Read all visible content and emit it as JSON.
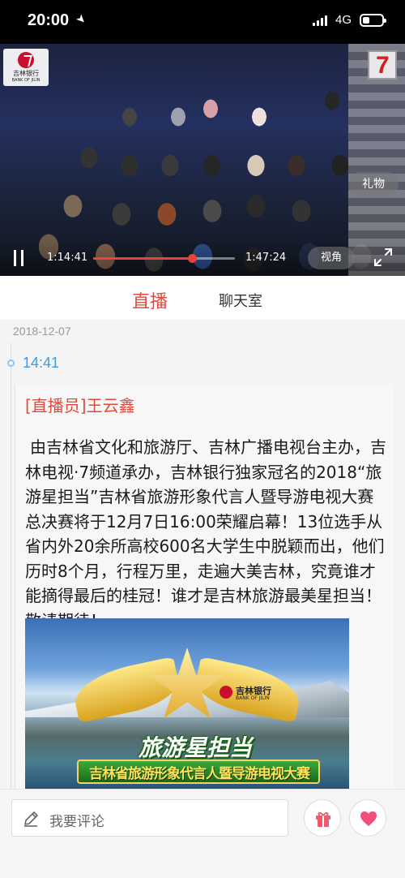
{
  "status_bar": {
    "time": "20:00",
    "network": "4G"
  },
  "player": {
    "channel_logo": {
      "text_cn": "吉林银行",
      "text_en": "BANK OF JILIN"
    },
    "gift_label": "礼物",
    "current_time": "1:14:41",
    "total_time": "1:47:24",
    "progress": 0.695,
    "angle_label": "视角"
  },
  "tabs": [
    {
      "label": "直播",
      "active": true
    },
    {
      "label": "聊天室",
      "active": false
    }
  ],
  "feed": {
    "date": "2018-12-07",
    "post": {
      "time": "14:41",
      "author": "[直播员]王云鑫",
      "body": "由吉林省文化和旅游厅、吉林广播电视台主办，吉林电视·7频道承办，吉林银行独家冠名的2018“旅游星担当”吉林省旅游形象代言人暨导游电视大赛总决赛将于12月7日16:00荣耀启幕！13位选手从省内外20余所高校600名大学生中脱颖而出，他们历时8个月，行程万里，走遍大美吉林，究竟谁才能摘得最后的桂冠！谁才是吉林旅游最美星担当！敬请期待！",
      "poster": {
        "sponsor_cn": "吉林银行",
        "sponsor_en": "BANK OF JILIN",
        "title": "旅游星担当",
        "subtitle": "吉林省旅游形象代言人暨导游电视大赛"
      }
    }
  },
  "comment_bar": {
    "placeholder": "我要评论"
  },
  "colors": {
    "accent": "#e04a3c",
    "timestamp": "#3b9de0"
  }
}
